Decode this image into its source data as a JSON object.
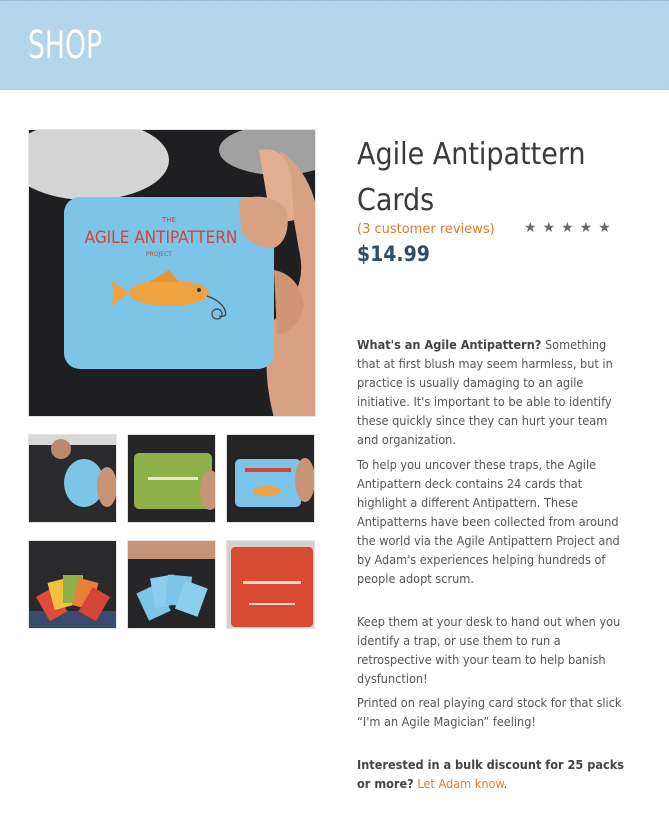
{
  "header": {
    "title": "SHOP"
  },
  "product": {
    "title": "Agile Antipattern Cards",
    "reviews": "(3 customer reviews)",
    "stars": "★★★★★",
    "price": "$14.99",
    "card_text": {
      "title_small": "THE",
      "title": "AGILE ANTIPATTERN",
      "sub": "PROJECT"
    }
  },
  "description": {
    "p1_bold": "What's an Agile Antipattern?",
    "p1_rest": " Something that at first blush may seem harmless, but in practice is usually damaging to an agile initiative. It's important to be able to identify these quickly since they can hurt your team and organization.",
    "p2": "To help you uncover these traps, the Agile Antipattern deck contains 24 cards that highlight a different Antipattern. These Antipatterns have been collected from around the world via the Agile Antipattern Project and by Adam's experiences helping hundreds of people adopt scrum.",
    "p3": "Keep them at your desk to hand out when you identify a trap, or use them to run a retrospective with your team to help banish dysfunction!",
    "p4": "Printed on real playing card stock for that slick “I'm an Agile Magician” feeling!",
    "p5_bold": "Interested in a bulk discount for 25 packs or more?",
    "p5_link": "Let Adam know",
    "p5_end": "."
  },
  "colors": {
    "header_bg": "#b3d3e8",
    "accent": "#e07a2c",
    "price": "#2e4d71",
    "card_blue": "#7cc4e8"
  }
}
